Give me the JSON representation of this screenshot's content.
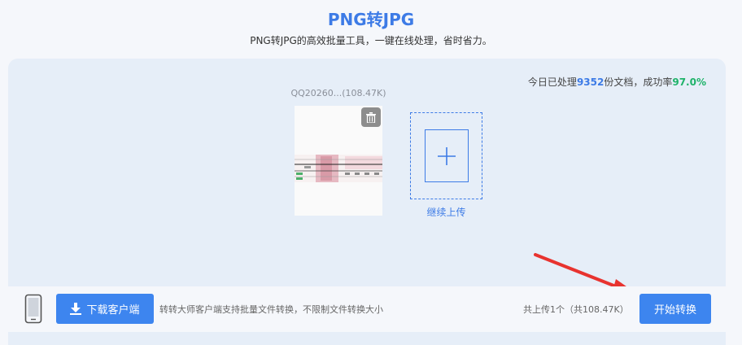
{
  "header": {
    "title": "PNG转JPG",
    "subtitle": "PNG转JPG的高效批量工具，一键在线处理，省时省力。"
  },
  "stats": {
    "prefix": "今日已处理",
    "count": "9352",
    "middle": "份文档，成功率",
    "rate": "97.0%",
    "colors": {
      "count": "#3d7be6",
      "rate": "#1fb36a"
    }
  },
  "file": {
    "name": "QQ20260...(108.47K)",
    "delete_icon": "trash-icon"
  },
  "upload_more": {
    "label": "继续上传",
    "icon": "plus-icon"
  },
  "bottom": {
    "download_label": "下载客户端",
    "download_icon": "download-icon",
    "phone_icon": "phone-icon",
    "note": "转转大师客户端支持批量文件转换，不限制文件转换大小",
    "upload_count": "共上传1个（共108.47K）",
    "start_label": "开始转换"
  },
  "colors": {
    "accent": "#3d7be6",
    "button": "#3d85ef",
    "panel": "#e6eef8",
    "arrow": "#e8332f"
  }
}
